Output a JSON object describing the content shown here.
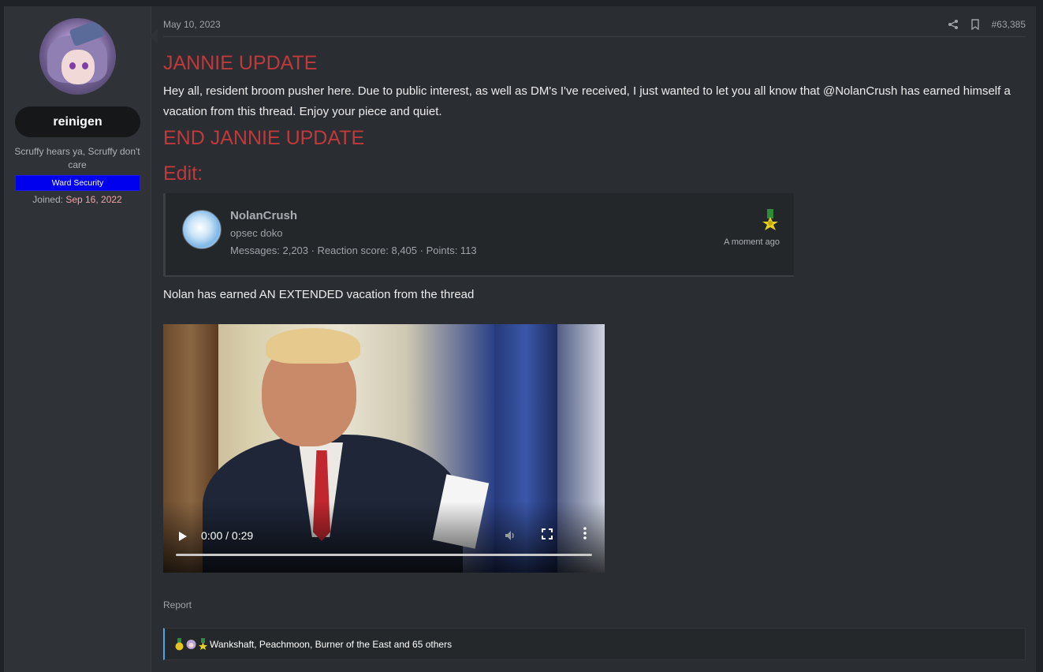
{
  "user": {
    "name": "reinigen",
    "title": "Scruffy hears ya, Scruffy don't care",
    "banner": "Ward Security",
    "joined_label": "Joined:",
    "joined_date": "Sep 16, 2022"
  },
  "post": {
    "date": "May 10, 2023",
    "number": "#63,385",
    "heading1": "JANNIE UPDATE",
    "body1": "Hey all, resident broom pusher here. Due to public interest, as well as DM's I've received, I just wanted to let you all know that @NolanCrush has earned himself a vacation from this thread. Enjoy your piece and quiet.",
    "heading2": "END JANNIE UPDATE",
    "heading3": "Edit:",
    "body2": "Nolan has earned AN EXTENDED vacation from the thread",
    "report": "Report"
  },
  "quote_card": {
    "name": "NolanCrush",
    "subtitle": "opsec doko",
    "stats": "Messages: 2,203 · Reaction score: 8,405 · Points: 113",
    "time": "A moment ago"
  },
  "video": {
    "time": "0:00 / 0:29",
    "progress": 0
  },
  "reactions": {
    "text": "Wankshaft, Peachmoon, Burner of the East and 65 others"
  },
  "icons": [
    "share-icon",
    "bookmark-icon",
    "play-icon",
    "volume-icon",
    "fullscreen-icon",
    "more-vertical-icon"
  ]
}
